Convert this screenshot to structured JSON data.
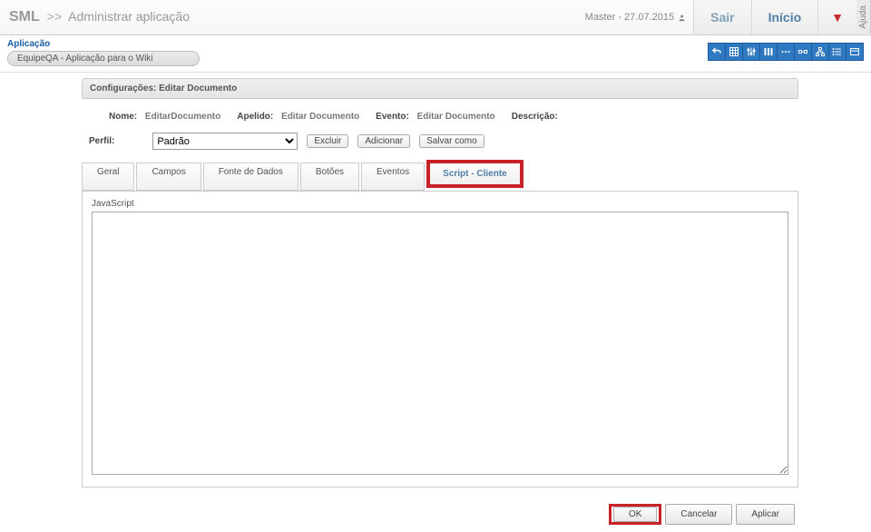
{
  "header": {
    "app_name": "SML",
    "separator": ">>",
    "page_title": "Administrar aplicação",
    "master_info": "Master - 27.07.2015",
    "sair": "Sair",
    "inicio": "Início",
    "help": "Ajuda"
  },
  "sub": {
    "app_label": "Aplicação",
    "app_dropdown": "EquipeQA - Aplicação para o Wiki"
  },
  "config": {
    "header": "Configurações: Editar Documento",
    "nome_lbl": "Nome:",
    "nome_val": "EditarDocumento",
    "apelido_lbl": "Apelido:",
    "apelido_val": "Editar Documento",
    "evento_lbl": "Evento:",
    "evento_val": "Editar Documento",
    "descricao_lbl": "Descrição:",
    "descricao_val": ""
  },
  "perfil": {
    "label": "Perfil:",
    "selected": "Padrão",
    "excluir": "Excluir",
    "adicionar": "Adicionar",
    "salvar_como": "Salvar como"
  },
  "tabs": {
    "geral": "Geral",
    "campos": "Campos",
    "fonte": "Fonte de Dados",
    "botoes": "Botões",
    "eventos": "Eventos",
    "script_cliente": "Script - Cliente"
  },
  "editor": {
    "label": "JavaScript",
    "value": ""
  },
  "actions": {
    "ok": "OK",
    "cancelar": "Cancelar",
    "aplicar": "Aplicar"
  }
}
